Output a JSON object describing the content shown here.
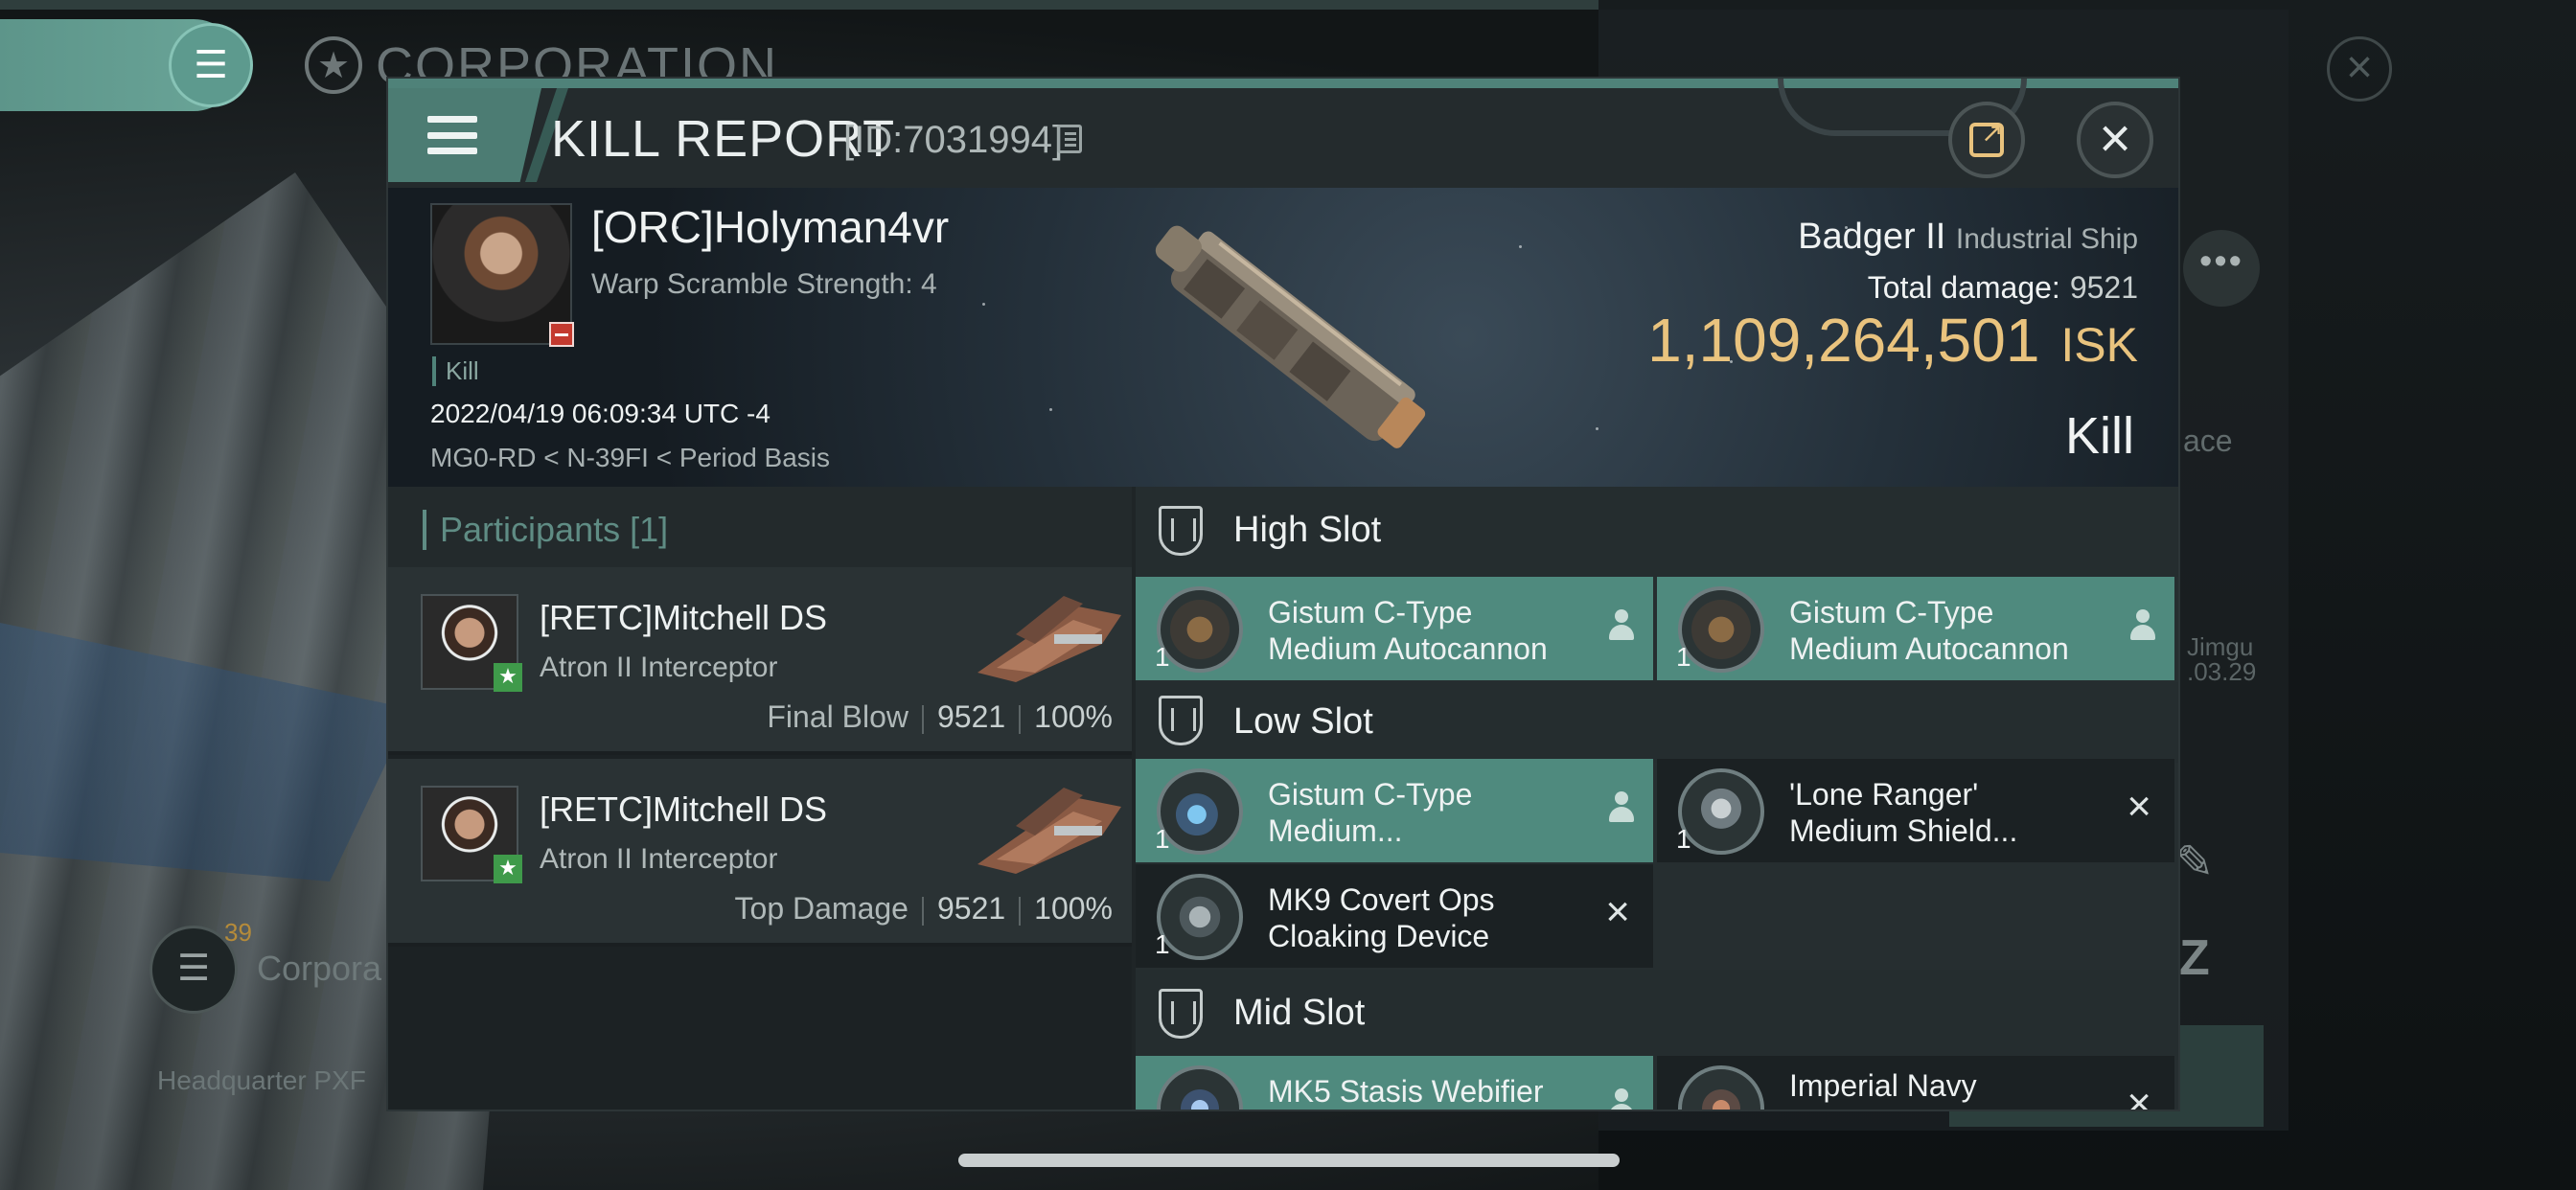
{
  "background": {
    "corp_title": "CORPORATION",
    "more_dots": "•••",
    "side_text": "ace",
    "jimgu": "Jimgu",
    "jimgu_date": ".03.29",
    "corp_count": "39",
    "corp_label": "Corpora",
    "hq_label": "Headquarter PXF"
  },
  "dialog": {
    "title": "KILL REPORT",
    "report_id": "[ID:7031994]",
    "icons": {
      "menu": "menu-icon",
      "copy": "copy-icon",
      "share": "share-icon",
      "close": "close-icon"
    }
  },
  "victim": {
    "name": "[ORC]Holyman4vr",
    "subtitle": "Warp Scramble Strength: 4",
    "tag": "Kill",
    "datetime": "2022/04/19 06:09:34 UTC -4",
    "location": "MG0-RD < N-39FI < Period Basis",
    "ship_name": "Badger II",
    "ship_class": "Industrial Ship",
    "total_damage_label": "Total damage:",
    "total_damage": "9521",
    "isk_value": "1,109,264,501",
    "isk_unit": "ISK",
    "result": "Kill"
  },
  "participants": {
    "header": "Participants [1]",
    "rows": [
      {
        "name": "[RETC]Mitchell DS",
        "ship": "Atron II Interceptor",
        "role": "Final Blow",
        "damage": "9521",
        "percent": "100%"
      },
      {
        "name": "[RETC]Mitchell DS",
        "ship": "Atron II Interceptor",
        "role": "Top Damage",
        "damage": "9521",
        "percent": "100%"
      }
    ]
  },
  "fitting": {
    "high_slot": {
      "title": "High Slot",
      "modules": [
        {
          "line1": "Gistum C-Type",
          "line2": "Medium Autocannon",
          "qty": "1",
          "state": "dropped"
        },
        {
          "line1": "Gistum C-Type",
          "line2": "Medium Autocannon",
          "qty": "1",
          "state": "dropped"
        }
      ]
    },
    "low_slot": {
      "title": "Low Slot",
      "modules": [
        {
          "line1": "Gistum C-Type",
          "line2": "Medium...",
          "qty": "1",
          "state": "dropped"
        },
        {
          "line1": "'Lone Ranger'",
          "line2": "Medium Shield...",
          "qty": "1",
          "state": "destroyed"
        },
        {
          "line1": "MK9 Covert Ops",
          "line2": "Cloaking Device",
          "qty": "1",
          "state": "destroyed"
        }
      ]
    },
    "mid_slot": {
      "title": "Mid Slot",
      "modules": [
        {
          "line1": "MK5 Stasis Webifier",
          "line2": "",
          "qty": "1",
          "state": "dropped"
        },
        {
          "line1": "Imperial Navy",
          "line2": "",
          "qty": "1",
          "state": "destroyed"
        }
      ]
    }
  },
  "colors": {
    "accent_teal": "#4f8a7e",
    "isk_gold": "#e9c37e",
    "attacker_badge": "#3f9a4a",
    "victim_badge": "#c43a2f"
  }
}
